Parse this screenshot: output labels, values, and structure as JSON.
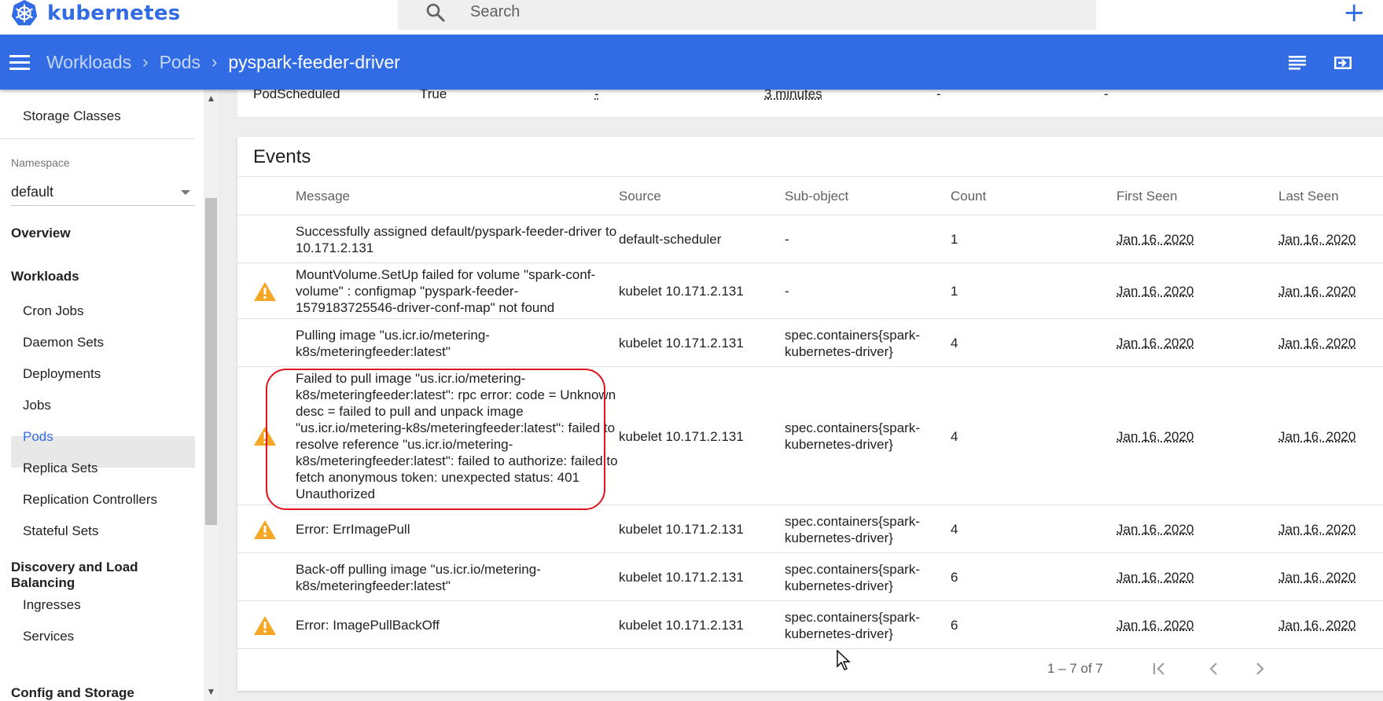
{
  "app": {
    "name": "kubernetes"
  },
  "search": {
    "placeholder": "Search"
  },
  "breadcrumb": {
    "items": [
      "Workloads",
      "Pods"
    ],
    "current": "pyspark-feeder-driver"
  },
  "sidebar": {
    "storage_classes": "Storage Classes",
    "namespace_label": "Namespace",
    "namespace_value": "default",
    "overview": "Overview",
    "workloads": "Workloads",
    "workload_items": [
      "Cron Jobs",
      "Daemon Sets",
      "Deployments",
      "Jobs",
      "Pods",
      "Replica Sets",
      "Replication Controllers",
      "Stateful Sets"
    ],
    "discovery": "Discovery and Load Balancing",
    "discovery_items": [
      "Ingresses",
      "Services"
    ],
    "config": "Config and Storage",
    "active_item": "Pods"
  },
  "conditions_row": {
    "type": "PodScheduled",
    "status": "True",
    "last_probe": "-",
    "last_transition": "3 minutes",
    "reason": "-",
    "message": "-"
  },
  "events": {
    "title": "Events",
    "columns": [
      "Message",
      "Source",
      "Sub-object",
      "Count",
      "First Seen",
      "Last Seen"
    ],
    "rows": [
      {
        "warning": false,
        "message": "Successfully assigned default/pyspark-feeder-driver to 10.171.2.131",
        "source": "default-scheduler",
        "subobject": "-",
        "count": "1",
        "first_seen": "Jan 16, 2020",
        "last_seen": "Jan 16, 2020"
      },
      {
        "warning": true,
        "message": "MountVolume.SetUp failed for volume \"spark-conf-volume\" : configmap \"pyspark-feeder-1579183725546-driver-conf-map\" not found",
        "source": "kubelet 10.171.2.131",
        "subobject": "-",
        "count": "1",
        "first_seen": "Jan 16, 2020",
        "last_seen": "Jan 16, 2020"
      },
      {
        "warning": false,
        "message": "Pulling image \"us.icr.io/metering-k8s/meteringfeeder:latest\"",
        "source": "kubelet 10.171.2.131",
        "subobject": "spec.containers{spark-kubernetes-driver}",
        "count": "4",
        "first_seen": "Jan 16, 2020",
        "last_seen": "Jan 16, 2020"
      },
      {
        "warning": true,
        "message": "Failed to pull image \"us.icr.io/metering-k8s/meteringfeeder:latest\": rpc error: code = Unknown desc = failed to pull and unpack image \"us.icr.io/metering-k8s/meteringfeeder:latest\": failed to resolve reference \"us.icr.io/metering-k8s/meteringfeeder:latest\": failed to authorize: failed to fetch anonymous token: unexpected status: 401 Unauthorized",
        "source": "kubelet 10.171.2.131",
        "subobject": "spec.containers{spark-kubernetes-driver}",
        "count": "4",
        "first_seen": "Jan 16, 2020",
        "last_seen": "Jan 16, 2020"
      },
      {
        "warning": true,
        "message": "Error: ErrImagePull",
        "source": "kubelet 10.171.2.131",
        "subobject": "spec.containers{spark-kubernetes-driver}",
        "count": "4",
        "first_seen": "Jan 16, 2020",
        "last_seen": "Jan 16, 2020"
      },
      {
        "warning": false,
        "message": "Back-off pulling image \"us.icr.io/metering-k8s/meteringfeeder:latest\"",
        "source": "kubelet 10.171.2.131",
        "subobject": "spec.containers{spark-kubernetes-driver}",
        "count": "6",
        "first_seen": "Jan 16, 2020",
        "last_seen": "Jan 16, 2020"
      },
      {
        "warning": true,
        "message": "Error: ImagePullBackOff",
        "source": "kubelet 10.171.2.131",
        "subobject": "spec.containers{spark-kubernetes-driver}",
        "count": "6",
        "first_seen": "Jan 16, 2020",
        "last_seen": "Jan 16, 2020"
      }
    ],
    "paginator": "1 – 7 of 7"
  },
  "icons": {
    "logo": "kubernetes-wheel-icon",
    "search": "search-icon",
    "create": "plus-icon",
    "menu": "menu-icon",
    "logs": "logs-icon",
    "exec": "exec-icon",
    "warning": "warning-icon"
  },
  "colors": {
    "brand": "#326ce5",
    "warning": "#f5a623",
    "highlight": "#e0141e"
  }
}
